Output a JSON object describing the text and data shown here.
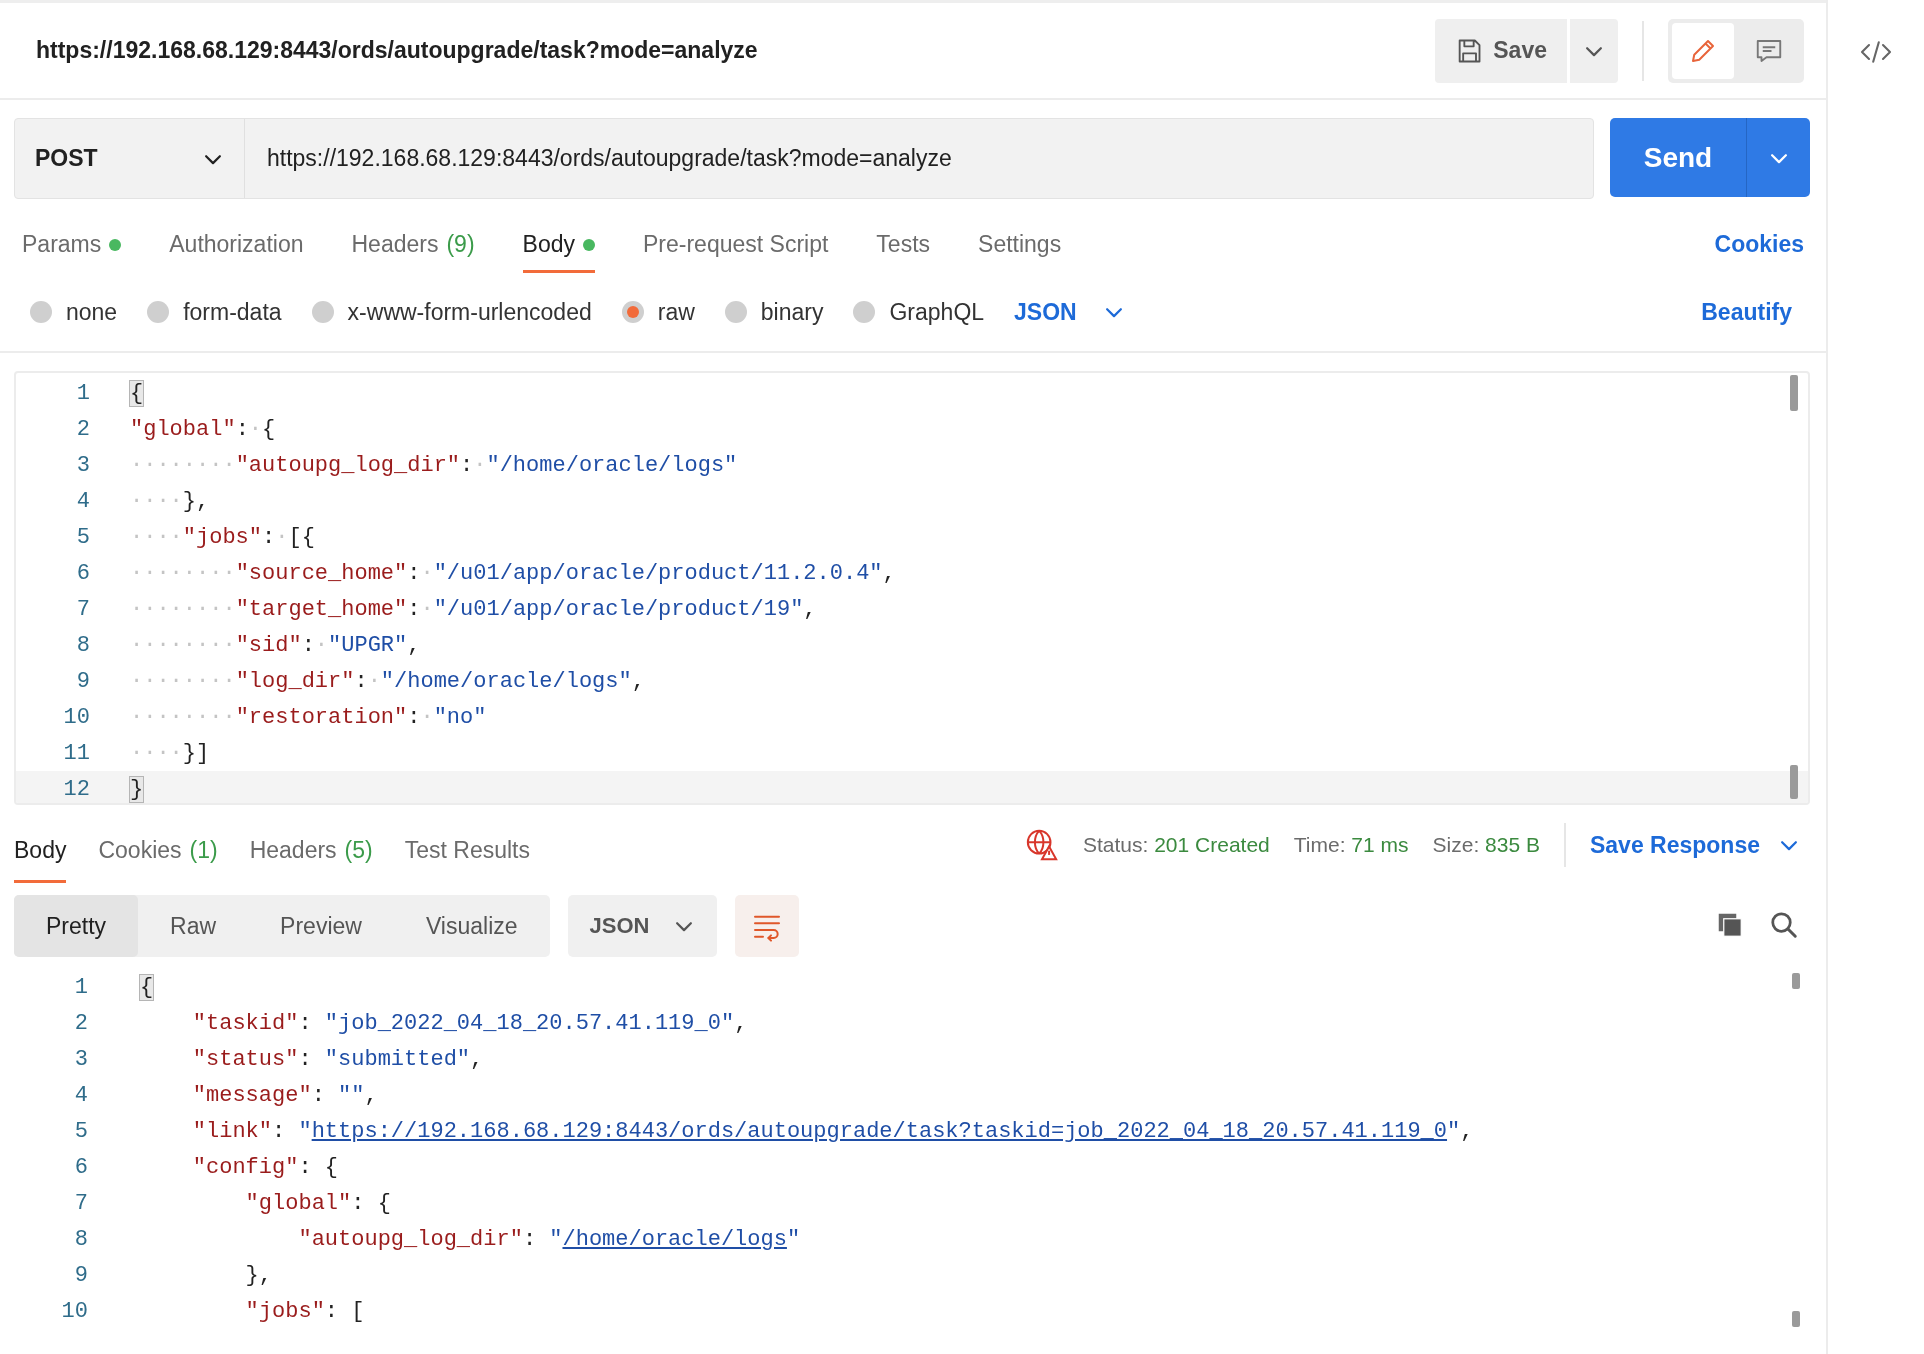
{
  "request_title": "https://192.168.68.129:8443/ords/autoupgrade/task?mode=analyze",
  "save_button": {
    "label": "Save"
  },
  "view_modes": [
    {
      "kind": "edit",
      "selected": true
    },
    {
      "kind": "comment",
      "selected": false
    }
  ],
  "method": "POST",
  "url": "https://192.168.68.129:8443/ords/autoupgrade/task?mode=analyze",
  "send_button": {
    "label": "Send"
  },
  "request_tabs": [
    {
      "label": "Params",
      "has_content": true,
      "selected": false
    },
    {
      "label": "Authorization",
      "selected": false
    },
    {
      "label": "Headers",
      "count": "(9)",
      "selected": false
    },
    {
      "label": "Body",
      "has_content": true,
      "selected": true
    },
    {
      "label": "Pre-request Script",
      "selected": false
    },
    {
      "label": "Tests",
      "selected": false
    },
    {
      "label": "Settings",
      "selected": false
    }
  ],
  "cookies_link": "Cookies",
  "body_types": [
    {
      "label": "none",
      "selected": false
    },
    {
      "label": "form-data",
      "selected": false
    },
    {
      "label": "x-www-form-urlencoded",
      "selected": false
    },
    {
      "label": "raw",
      "selected": true
    },
    {
      "label": "binary",
      "selected": false
    },
    {
      "label": "GraphQL",
      "selected": false
    }
  ],
  "body_language": "JSON",
  "beautify_link": "Beautify",
  "request_body": {
    "lines": [
      {
        "number": "1",
        "tokens": [
          {
            "kind": "bracket",
            "text": "{"
          }
        ]
      },
      {
        "number": "2",
        "tokens": [
          {
            "kind": "key",
            "text": "\"global\""
          },
          {
            "kind": "punct",
            "text": ":"
          },
          {
            "kind": "ws",
            "text": "·"
          },
          {
            "kind": "punct",
            "text": "{"
          }
        ]
      },
      {
        "number": "3",
        "tokens": [
          {
            "kind": "ws",
            "text": "········"
          },
          {
            "kind": "key",
            "text": "\"autoupg_log_dir\""
          },
          {
            "kind": "punct",
            "text": ":"
          },
          {
            "kind": "ws",
            "text": "·"
          },
          {
            "kind": "str",
            "text": "\"/home/oracle/logs\""
          }
        ]
      },
      {
        "number": "4",
        "tokens": [
          {
            "kind": "ws",
            "text": "····"
          },
          {
            "kind": "punct",
            "text": "},"
          }
        ]
      },
      {
        "number": "5",
        "tokens": [
          {
            "kind": "ws",
            "text": "····"
          },
          {
            "kind": "key",
            "text": "\"jobs\""
          },
          {
            "kind": "punct",
            "text": ":"
          },
          {
            "kind": "ws",
            "text": "·"
          },
          {
            "kind": "punct",
            "text": "[{"
          }
        ]
      },
      {
        "number": "6",
        "tokens": [
          {
            "kind": "ws",
            "text": "········"
          },
          {
            "kind": "key",
            "text": "\"source_home\""
          },
          {
            "kind": "punct",
            "text": ":"
          },
          {
            "kind": "ws",
            "text": "·"
          },
          {
            "kind": "str",
            "text": "\"/u01/app/oracle/product/11.2.0.4\""
          },
          {
            "kind": "punct",
            "text": ","
          }
        ]
      },
      {
        "number": "7",
        "tokens": [
          {
            "kind": "ws",
            "text": "········"
          },
          {
            "kind": "key",
            "text": "\"target_home\""
          },
          {
            "kind": "punct",
            "text": ":"
          },
          {
            "kind": "ws",
            "text": "·"
          },
          {
            "kind": "str",
            "text": "\"/u01/app/oracle/product/19\""
          },
          {
            "kind": "punct",
            "text": ","
          }
        ]
      },
      {
        "number": "8",
        "tokens": [
          {
            "kind": "ws",
            "text": "········"
          },
          {
            "kind": "key",
            "text": "\"sid\""
          },
          {
            "kind": "punct",
            "text": ":"
          },
          {
            "kind": "ws",
            "text": "·"
          },
          {
            "kind": "str",
            "text": "\"UPGR\""
          },
          {
            "kind": "punct",
            "text": ","
          }
        ]
      },
      {
        "number": "9",
        "tokens": [
          {
            "kind": "ws",
            "text": "········"
          },
          {
            "kind": "key",
            "text": "\"log_dir\""
          },
          {
            "kind": "punct",
            "text": ":"
          },
          {
            "kind": "ws",
            "text": "·"
          },
          {
            "kind": "str",
            "text": "\"/home/oracle/logs\""
          },
          {
            "kind": "punct",
            "text": ","
          }
        ]
      },
      {
        "number": "10",
        "tokens": [
          {
            "kind": "ws",
            "text": "········"
          },
          {
            "kind": "key",
            "text": "\"restoration\""
          },
          {
            "kind": "punct",
            "text": ":"
          },
          {
            "kind": "ws",
            "text": "·"
          },
          {
            "kind": "str",
            "text": "\"no\""
          }
        ]
      },
      {
        "number": "11",
        "tokens": [
          {
            "kind": "ws",
            "text": "····"
          },
          {
            "kind": "punct",
            "text": "}]"
          }
        ]
      },
      {
        "number": "12",
        "tokens": [
          {
            "kind": "bracket",
            "text": "}"
          }
        ]
      }
    ]
  },
  "response_tabs": [
    {
      "label": "Body",
      "selected": true
    },
    {
      "label": "Cookies",
      "count": "(1)",
      "selected": false
    },
    {
      "label": "Headers",
      "count": "(5)",
      "selected": false
    },
    {
      "label": "Test Results",
      "selected": false
    }
  ],
  "status": {
    "label": "Status:",
    "value": "201 Created"
  },
  "time": {
    "label": "Time:",
    "value": "71 ms"
  },
  "size": {
    "label": "Size:",
    "value": "835 B"
  },
  "save_response": "Save Response",
  "response_views": [
    {
      "label": "Pretty",
      "selected": true
    },
    {
      "label": "Raw",
      "selected": false
    },
    {
      "label": "Preview",
      "selected": false
    },
    {
      "label": "Visualize",
      "selected": false
    }
  ],
  "response_format": "JSON",
  "wrap_lines_on": true,
  "response_body": {
    "lines": [
      {
        "number": "1",
        "tokens": [
          {
            "kind": "bracket",
            "text": "{"
          }
        ]
      },
      {
        "number": "2",
        "tokens": [
          {
            "kind": "key",
            "text": "    \"taskid\""
          },
          {
            "kind": "punct",
            "text": ": "
          },
          {
            "kind": "str",
            "text": "\"job_2022_04_18_20.57.41.119_0\""
          },
          {
            "kind": "punct",
            "text": ","
          }
        ]
      },
      {
        "number": "3",
        "tokens": [
          {
            "kind": "key",
            "text": "    \"status\""
          },
          {
            "kind": "punct",
            "text": ": "
          },
          {
            "kind": "str",
            "text": "\"submitted\""
          },
          {
            "kind": "punct",
            "text": ","
          }
        ]
      },
      {
        "number": "4",
        "tokens": [
          {
            "kind": "key",
            "text": "    \"message\""
          },
          {
            "kind": "punct",
            "text": ": "
          },
          {
            "kind": "str",
            "text": "\"\""
          },
          {
            "kind": "punct",
            "text": ","
          }
        ]
      },
      {
        "number": "5",
        "tokens": [
          {
            "kind": "key",
            "text": "    \"link\""
          },
          {
            "kind": "punct",
            "text": ": "
          },
          {
            "kind": "str",
            "text": "\""
          },
          {
            "kind": "link",
            "text": "https://192.168.68.129:8443/ords/autoupgrade/task?taskid=job_2022_04_18_20.57.41.119_0"
          },
          {
            "kind": "str",
            "text": "\""
          },
          {
            "kind": "punct",
            "text": ","
          }
        ]
      },
      {
        "number": "6",
        "tokens": [
          {
            "kind": "key",
            "text": "    \"config\""
          },
          {
            "kind": "punct",
            "text": ": {"
          }
        ]
      },
      {
        "number": "7",
        "tokens": [
          {
            "kind": "key",
            "text": "        \"global\""
          },
          {
            "kind": "punct",
            "text": ": {"
          }
        ]
      },
      {
        "number": "8",
        "tokens": [
          {
            "kind": "key",
            "text": "            \"autoupg_log_dir\""
          },
          {
            "kind": "punct",
            "text": ": "
          },
          {
            "kind": "str",
            "text": "\""
          },
          {
            "kind": "link",
            "text": "/home/oracle/logs"
          },
          {
            "kind": "str",
            "text": "\""
          }
        ]
      },
      {
        "number": "9",
        "tokens": [
          {
            "kind": "punct",
            "text": "        },"
          }
        ]
      },
      {
        "number": "10",
        "tokens": [
          {
            "kind": "key",
            "text": "        \"jobs\""
          },
          {
            "kind": "punct",
            "text": ": ["
          }
        ]
      }
    ]
  }
}
